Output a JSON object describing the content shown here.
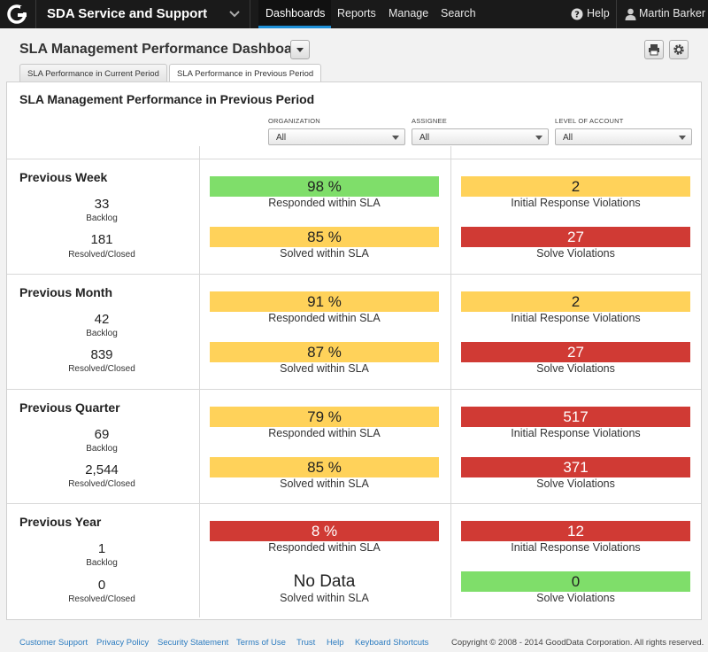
{
  "topbar": {
    "app_title": "SDA Service and Support",
    "nav": [
      "Dashboards",
      "Reports",
      "Manage",
      "Search"
    ],
    "help": "Help",
    "user": "Martin Barker"
  },
  "header": {
    "title": "SLA Management Performance Dashboard"
  },
  "tabs": [
    {
      "label": "SLA Performance in Current Period",
      "active": false
    },
    {
      "label": "SLA Performance in Previous Period",
      "active": true
    }
  ],
  "section": {
    "title": "SLA Management Performance in Previous Period"
  },
  "filters": [
    {
      "label": "ORGANIZATION",
      "value": "All"
    },
    {
      "label": "ASSIGNEE",
      "value": "All"
    },
    {
      "label": "LEVEL OF ACCOUNT",
      "value": "All"
    }
  ],
  "colors": {
    "green": "#7fde6a",
    "yellow": "#ffd25a",
    "red": "#d03a34",
    "nav_accent": "#1e8fd6"
  },
  "periods": [
    {
      "title": "Previous Week",
      "backlog": "33",
      "backlog_label": "Backlog",
      "resolved": "181",
      "resolved_label": "Resolved/Closed",
      "responded": {
        "value": "98 %",
        "label": "Responded within SLA",
        "status": "green"
      },
      "solved": {
        "value": "85 %",
        "label": "Solved within SLA",
        "status": "yellow"
      },
      "initial_violations": {
        "value": "2",
        "label": "Initial Response Violations",
        "status": "yellow"
      },
      "solve_violations": {
        "value": "27",
        "label": "Solve Violations",
        "status": "red"
      }
    },
    {
      "title": "Previous Month",
      "backlog": "42",
      "backlog_label": "Backlog",
      "resolved": "839",
      "resolved_label": "Resolved/Closed",
      "responded": {
        "value": "91 %",
        "label": "Responded within SLA",
        "status": "yellow"
      },
      "solved": {
        "value": "87 %",
        "label": "Solved within SLA",
        "status": "yellow"
      },
      "initial_violations": {
        "value": "2",
        "label": "Initial Response Violations",
        "status": "yellow"
      },
      "solve_violations": {
        "value": "27",
        "label": "Solve Violations",
        "status": "red"
      }
    },
    {
      "title": "Previous Quarter",
      "backlog": "69",
      "backlog_label": "Backlog",
      "resolved": "2,544",
      "resolved_label": "Resolved/Closed",
      "responded": {
        "value": "79 %",
        "label": "Responded within SLA",
        "status": "yellow"
      },
      "solved": {
        "value": "85 %",
        "label": "Solved within SLA",
        "status": "yellow"
      },
      "initial_violations": {
        "value": "517",
        "label": "Initial Response Violations",
        "status": "red"
      },
      "solve_violations": {
        "value": "371",
        "label": "Solve Violations",
        "status": "red"
      }
    },
    {
      "title": "Previous Year",
      "backlog": "1",
      "backlog_label": "Backlog",
      "resolved": "0",
      "resolved_label": "Resolved/Closed",
      "responded": {
        "value": "8 %",
        "label": "Responded within SLA",
        "status": "red"
      },
      "solved": {
        "value": "No Data",
        "label": "Solved within SLA",
        "status": "none"
      },
      "initial_violations": {
        "value": "12",
        "label": "Initial Response Violations",
        "status": "red"
      },
      "solve_violations": {
        "value": "0",
        "label": "Solve Violations",
        "status": "green"
      }
    }
  ],
  "footer": {
    "links": [
      "Customer Support",
      "Privacy Policy",
      "Security Statement",
      "Terms of Use",
      "Trust",
      "Help",
      "Keyboard Shortcuts"
    ],
    "copyright": "Copyright © 2008 - 2014 GoodData Corporation. All rights reserved."
  }
}
